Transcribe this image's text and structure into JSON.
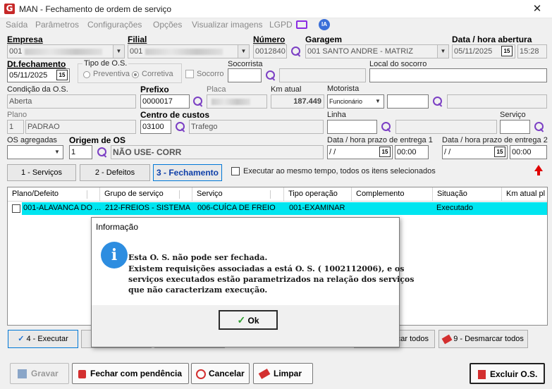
{
  "window": {
    "title": "MAN - Fechamento de ordem de serviço",
    "close": "✕"
  },
  "menu": [
    "Saída",
    "Parâmetros",
    "Configurações",
    "Opções",
    "Visualizar imagens",
    "LGPD"
  ],
  "ia_badge": "IA",
  "labels": {
    "empresa": "Empresa",
    "filial": "Filial",
    "numero": "Número",
    "garagem": "Garagem",
    "data_abertura": "Data / hora abertura",
    "dt_fechamento": "Dt.fechamento",
    "tipo_os": "Tipo de O.S.",
    "preventiva": "Preventiva",
    "corretiva": "Corretiva",
    "socorro": "Socorro",
    "socorrista": "Socorrista",
    "local_socorro": "Local do socorro",
    "condicao": "Condição da O.S.",
    "prefixo": "Prefixo",
    "placa": "Placa",
    "km_atual": "Km atual",
    "motorista": "Motorista",
    "plano": "Plano",
    "centro_custos": "Centro de custos",
    "linha": "Linha",
    "servico": "Serviço",
    "os_agregadas": "OS agregadas",
    "origem_os": "Origem de OS",
    "prazo1": "Data / hora prazo de entrega 1",
    "prazo2": "Data / hora prazo de entrega 2"
  },
  "values": {
    "empresa": "001",
    "filial": "001",
    "numero": "0012840",
    "garagem": "001 SANTO ANDRE - MATRIZ",
    "data_abertura": "05/11/2025",
    "hora_abertura": "15:28",
    "dt_fechamento": "05/11/2025",
    "condicao": "Aberta",
    "prefixo": "0000017",
    "km_atual": "187.449",
    "motorista_tipo": "Funcionário",
    "plano_cod": "1",
    "plano_nome": "PADRAO",
    "centro_cod": "03100",
    "centro_nome": "Trafego",
    "linha": "",
    "origem_cod": "1",
    "origem_nome": "NÃO USE- CORR",
    "prazo1_data": " / /",
    "prazo1_hora": "00:00",
    "prazo2_data": " / /",
    "prazo2_hora": "00:00"
  },
  "tabs": {
    "t1": "1 - Serviços",
    "t2": "2 - Defeitos",
    "t3": "3 - Fechamento",
    "exec_all": "Executar ao mesmo tempo, todos os itens selecionados"
  },
  "grid": {
    "headers": [
      "Plano/Defeito",
      "Grupo de serviço",
      "Serviço",
      "Tipo operação",
      "Complemento",
      "Situação",
      "Km atual pl"
    ],
    "row": [
      "001-ALAVANCA DO ...",
      "212-FREIOS - SISTEMA",
      "006-CUÍCA DE FREIO",
      "001-EXAMINAR",
      "",
      "Executado"
    ]
  },
  "actions": {
    "executar": "4 - Executar",
    "marcar_todos": "car todos",
    "desmarcar": "9 - Desmarcar todos"
  },
  "footer": {
    "gravar": "Gravar",
    "pendencia": "Fechar com pendência",
    "cancelar": "Cancelar",
    "limpar": "Limpar",
    "excluir": "Excluir O.S."
  },
  "dialog": {
    "title": "Informação",
    "line1": "Esta O. S. não pode ser fechada.",
    "line2": "Existem requisições associadas a está O. S. ( 1002112006), e os",
    "line3": "serviços executados estão parametrizados na relação dos serviços",
    "line4": "que não caracterizam execução.",
    "ok": "Ok"
  },
  "colors": {
    "accent": "#0078d7",
    "selected_row": "#00e5f0",
    "search_icon": "#7b3fc4",
    "info_icon": "#2d8de0"
  }
}
